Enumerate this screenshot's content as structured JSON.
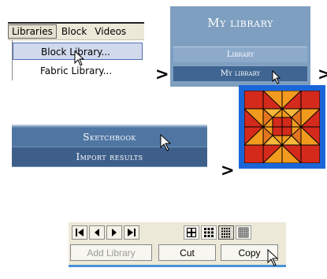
{
  "menu_bar": {
    "items": [
      "Libraries",
      "Block",
      "Videos"
    ],
    "dropdown": [
      "Block Library...",
      "Fabric Library..."
    ]
  },
  "library_panel": {
    "title": "My library",
    "buttons": [
      "Library",
      "My library"
    ]
  },
  "sketchbook_panel": {
    "buttons": [
      "Sketchbook",
      "Import results"
    ]
  },
  "toolbar": {
    "nav_icons": [
      "first-icon",
      "prev-icon",
      "next-icon",
      "last-icon"
    ],
    "view_icons": [
      "grid-2x2-icon",
      "grid-3x3-icon",
      "grid-4x4-icon",
      "grid-5x5-icon"
    ],
    "buttons": [
      "Add Library",
      "Cut",
      "Copy"
    ]
  },
  "arrows": [
    ">",
    ">",
    ">"
  ],
  "colors": {
    "library_blue": "#7f9fc0",
    "quilt_red": "#d42a1c",
    "quilt_orange": "#f19a1e",
    "frame_blue": "#1a66d8"
  }
}
